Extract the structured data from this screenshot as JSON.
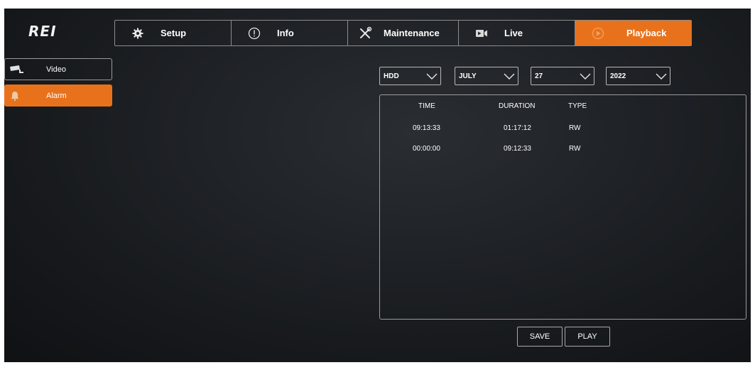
{
  "brand": {
    "logo_text": "REI"
  },
  "topnav": {
    "tabs": [
      {
        "label": "Setup",
        "icon": "gear-icon"
      },
      {
        "label": "Info",
        "icon": "info-icon"
      },
      {
        "label": "Maintenance",
        "icon": "wrench-icon"
      },
      {
        "label": "Live",
        "icon": "video-camera-icon"
      },
      {
        "label": "Playback",
        "icon": "playback-icon",
        "active": true
      }
    ]
  },
  "sidebar": {
    "items": [
      {
        "label": "Video",
        "icon": "security-camera-icon"
      },
      {
        "label": "Alarm",
        "icon": "bell-icon",
        "active": true
      }
    ]
  },
  "filters": {
    "storage": "HDD",
    "month": "JULY",
    "day": "27",
    "year": "2022"
  },
  "table": {
    "headers": {
      "time": "TIME",
      "duration": "DURATION",
      "type": "TYPE"
    },
    "rows": [
      {
        "time": "09:13:33",
        "duration": "01:17:12",
        "type": "RW"
      },
      {
        "time": "00:00:00",
        "duration": "09:12:33",
        "type": "RW"
      }
    ]
  },
  "actions": {
    "save_label": "SAVE",
    "play_label": "PLAY"
  },
  "colors": {
    "accent": "#e8721c",
    "background": "#1d2024",
    "border": "#9a9a9a"
  }
}
